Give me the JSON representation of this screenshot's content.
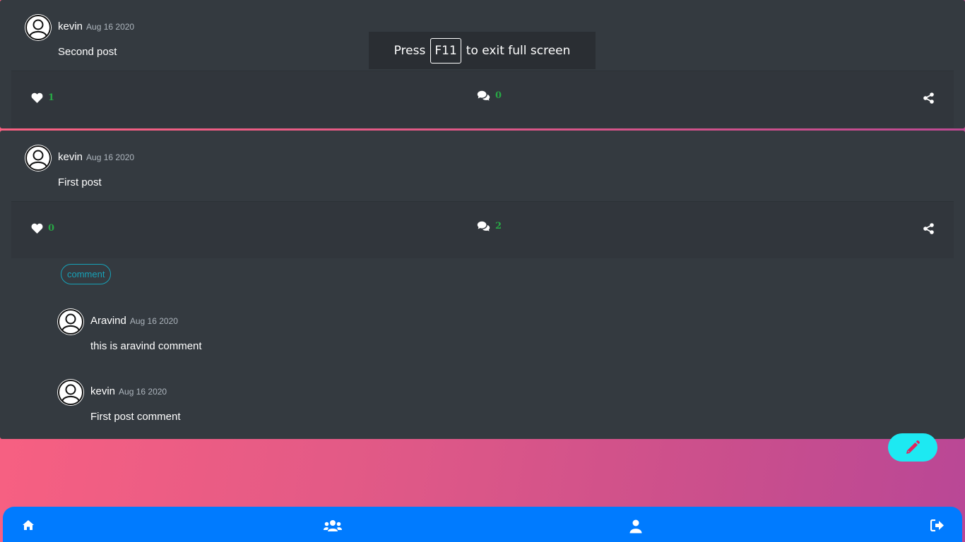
{
  "posts": [
    {
      "author": "kevin",
      "date": "Aug 16 2020",
      "text": "Second post",
      "likes": "1",
      "comments": "0"
    },
    {
      "author": "kevin",
      "date": "Aug 16 2020",
      "text": "First post",
      "likes": "0",
      "comments": "2",
      "comment_button": "comment",
      "comment_list": [
        {
          "author": "Aravind",
          "date": "Aug 16 2020",
          "text": "this is aravind comment"
        },
        {
          "author": "kevin",
          "date": "Aug 16 2020",
          "text": "First post comment"
        }
      ]
    }
  ],
  "fullscreen_notice": {
    "press": "Press",
    "key": "F11",
    "suffix": "to exit full screen"
  },
  "colors": {
    "accent": "#007bff",
    "count": "#28a745",
    "fab": "#1de9f2",
    "card": "#343a40"
  },
  "icons": {
    "like": "heart-icon",
    "comments": "comments-icon",
    "share": "share-icon",
    "fab": "pencil-icon",
    "nav": [
      "home-icon",
      "users-icon",
      "user-icon",
      "sign-out-icon"
    ]
  }
}
